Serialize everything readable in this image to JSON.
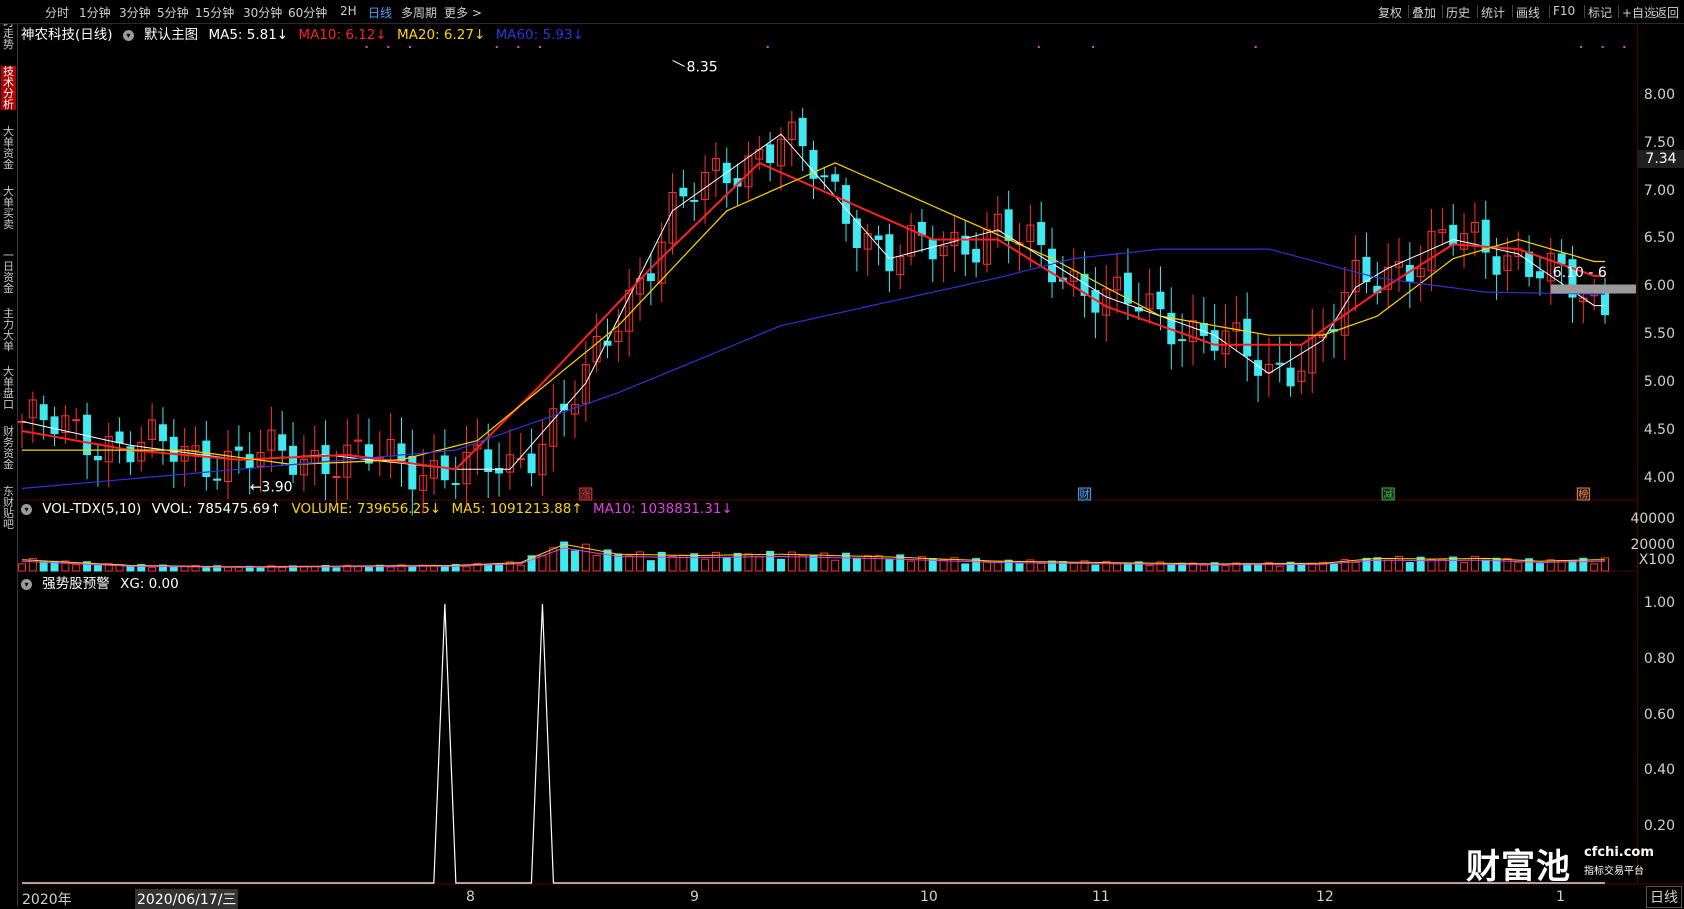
{
  "sidebar": {
    "tabs": [
      {
        "label": "分时走势",
        "active": false
      },
      {
        "label": "技术分析",
        "active": true
      },
      {
        "label": "大单资金",
        "active": false
      },
      {
        "label": "大单买卖",
        "active": false
      },
      {
        "label": "一日资金",
        "active": false
      },
      {
        "label": "主力大单",
        "active": false
      },
      {
        "label": "大单盘口",
        "active": false
      },
      {
        "label": "财务资金",
        "active": false
      },
      {
        "label": "东财贴吧",
        "active": false
      }
    ]
  },
  "toolbar": {
    "periods": [
      {
        "label": "分时",
        "active": false
      },
      {
        "label": "1分钟",
        "active": false
      },
      {
        "label": "3分钟",
        "active": false
      },
      {
        "label": "5分钟",
        "active": false
      },
      {
        "label": "15分钟",
        "active": false
      },
      {
        "label": "30分钟",
        "active": false
      },
      {
        "label": "60分钟",
        "active": false
      },
      {
        "label": "2H",
        "active": false
      },
      {
        "label": "日线",
        "active": true
      },
      {
        "label": "多周期",
        "active": false
      },
      {
        "label": "更多 >",
        "active": false
      }
    ],
    "tools": [
      "复权",
      "叠加",
      "历史",
      "统计",
      "画线",
      "F10",
      "标记",
      "+自选",
      "返回"
    ]
  },
  "main_panel": {
    "title": "神农科技(日线)",
    "template": "默认主图",
    "ma5": "MA5: 5.81↓",
    "ma10": "MA10: 6.12↓",
    "ma20": "MA20: 6.27↓",
    "ma60": "MA60: 5.93↓",
    "high_label": "8.35",
    "low_label": "3.90",
    "range_label": "6.10 - 6",
    "current_price": "7.34",
    "event_marks": [
      "涨",
      "财",
      "减",
      "榜"
    ],
    "colors": {
      "ma5": "#ffffff",
      "ma10": "#ff2020",
      "ma20": "#ffd400",
      "ma60": "#2b35d8",
      "up": "#ff3030",
      "down": "#40e8f0"
    }
  },
  "volume_panel": {
    "title": "VOL-TDX(5,10)",
    "vvol": "VVOL: 785475.69↑",
    "volume": "VOLUME: 739656.25↓",
    "ma5": "MA5: 1091213.88↑",
    "ma10": "MA10: 1038831.31↓",
    "unit": "X100"
  },
  "indicator_panel": {
    "title": "强势股预警",
    "xg": "XG: 0.00"
  },
  "x_axis": {
    "labels": [
      "2020年",
      "2020/06/17/三",
      "8",
      "9",
      "10",
      "11",
      "12",
      "1"
    ],
    "period_button": "日线"
  },
  "watermark": {
    "brand": "财富池",
    "domain": "cfchi.com",
    "tagline": "指标交易平台"
  },
  "chart_data": [
    {
      "type": "line",
      "title": "神农科技(日线)",
      "y_ticks": [
        "8.00",
        "7.50",
        "7.00",
        "6.50",
        "6.00",
        "5.50",
        "5.00",
        "4.50",
        "4.00"
      ],
      "ylim": [
        3.8,
        8.5
      ],
      "n_days": 147,
      "series": [
        {
          "name": "MA5",
          "x_day": [
            0,
            10,
            20,
            28,
            40,
            45,
            52,
            60,
            70,
            80,
            90,
            100,
            110,
            115,
            120,
            123,
            126,
            132,
            138,
            145
          ],
          "y": [
            4.6,
            4.35,
            4.2,
            4.25,
            4.1,
            4.1,
            5.0,
            6.8,
            7.6,
            6.3,
            6.6,
            5.9,
            5.5,
            5.1,
            5.45,
            6.0,
            6.2,
            6.5,
            6.35,
            5.81
          ]
        },
        {
          "name": "MA10",
          "x_day": [
            0,
            10,
            20,
            30,
            40,
            48,
            58,
            68,
            78,
            84,
            90,
            100,
            110,
            118,
            125,
            132,
            138,
            145
          ],
          "y": [
            4.5,
            4.3,
            4.2,
            4.25,
            4.1,
            5.0,
            6.2,
            7.3,
            6.8,
            6.5,
            6.5,
            5.8,
            5.4,
            5.4,
            5.95,
            6.45,
            6.4,
            6.12
          ]
        },
        {
          "name": "MA20",
          "x_day": [
            0,
            15,
            25,
            35,
            42,
            55,
            65,
            75,
            85,
            95,
            105,
            115,
            120,
            125,
            132,
            138,
            145
          ],
          "y": [
            4.3,
            4.3,
            4.15,
            4.2,
            4.4,
            5.6,
            6.8,
            7.3,
            6.8,
            6.3,
            5.7,
            5.5,
            5.5,
            5.7,
            6.3,
            6.5,
            6.27
          ]
        },
        {
          "name": "MA60",
          "x_day": [
            0,
            20,
            40,
            55,
            70,
            90,
            97,
            105,
            115,
            125,
            135,
            145
          ],
          "y": [
            3.9,
            4.1,
            4.3,
            4.9,
            5.6,
            6.1,
            6.3,
            6.4,
            6.4,
            6.1,
            5.95,
            5.93
          ]
        }
      ]
    },
    {
      "type": "bar",
      "title": "VOL-TDX(5,10)",
      "y_ticks": [
        "40000",
        "20000"
      ],
      "ylim": [
        0,
        40000
      ],
      "volume_profile_x_day": [
        0,
        10,
        20,
        30,
        40,
        46,
        50,
        55,
        62,
        70,
        80,
        90,
        100,
        110,
        120,
        125,
        130,
        135,
        140,
        145
      ],
      "volume_profile": [
        8000,
        4000,
        3000,
        3500,
        4000,
        6000,
        19000,
        12000,
        11000,
        12000,
        10000,
        7000,
        6000,
        5000,
        5500,
        9000,
        8500,
        9000,
        7000,
        8000
      ]
    },
    {
      "type": "line",
      "title": "强势股预警",
      "y_ticks": [
        "1.00",
        "0.80",
        "0.60",
        "0.40",
        "0.20"
      ],
      "ylim": [
        0,
        1.05
      ],
      "spike_days": [
        39,
        48
      ],
      "value": 0.0
    }
  ]
}
